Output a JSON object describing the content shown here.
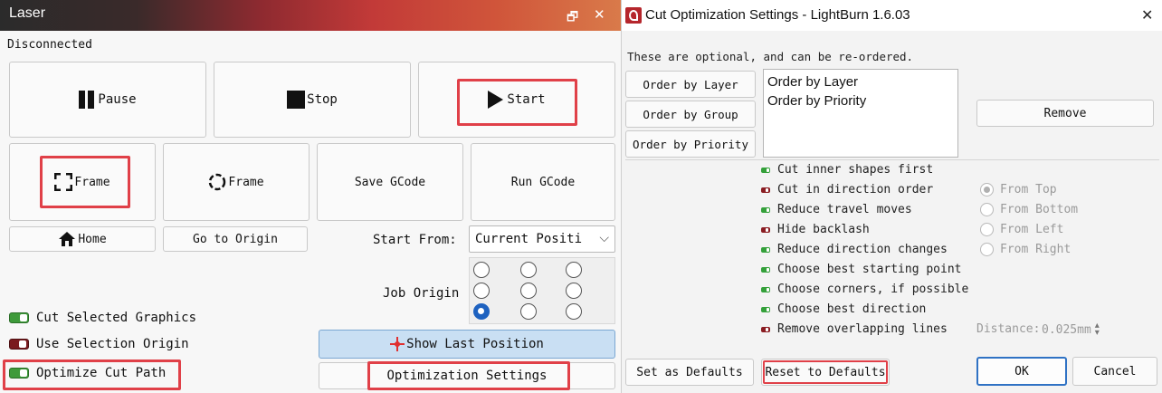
{
  "laser_panel": {
    "title": "Laser",
    "restore_glyph": "🗗",
    "close_glyph": "✕",
    "status": "Disconnected",
    "pause_label": "Pause",
    "stop_label": "Stop",
    "start_label": "Start",
    "frame_label": "Frame",
    "frame_circle_label": "Frame",
    "save_gcode_label": "Save GCode",
    "run_gcode_label": "Run GCode",
    "home_label": "Home",
    "go_to_origin_label": "Go to Origin",
    "start_from_label": "Start From:",
    "start_from_value": "Current Positi",
    "job_origin_label": "Job Origin",
    "job_origin_selected": "bottom-left",
    "cut_selected_label": "Cut Selected Graphics",
    "cut_selected_on": true,
    "use_selection_origin_label": "Use Selection Origin",
    "use_selection_origin_on": false,
    "optimize_cut_path_label": "Optimize Cut Path",
    "optimize_cut_path_on": true,
    "show_last_position_label": "Show Last Position",
    "optimization_settings_label": "Optimization Settings"
  },
  "dialog": {
    "title": "Cut Optimization Settings - LightBurn 1.6.03",
    "close_glyph": "✕",
    "intro": "These are optional, and can be re-ordered.",
    "order_by_layer_label": "Order by Layer",
    "order_by_group_label": "Order by Group",
    "order_by_priority_label": "Order by Priority",
    "order_list": [
      "Order by Layer",
      "Order by Priority"
    ],
    "remove_label": "Remove",
    "options": [
      {
        "label": "Cut inner shapes first",
        "on": true
      },
      {
        "label": "Cut in direction order",
        "on": false
      },
      {
        "label": "Reduce travel moves",
        "on": true
      },
      {
        "label": "Hide backlash",
        "on": false
      },
      {
        "label": "Reduce direction changes",
        "on": true
      },
      {
        "label": "Choose best starting point",
        "on": true
      },
      {
        "label": "Choose corners, if possible",
        "on": true
      },
      {
        "label": "Choose best direction",
        "on": true
      },
      {
        "label": "Remove overlapping lines",
        "on": false
      }
    ],
    "directions": [
      "From Top",
      "From Bottom",
      "From Left",
      "From Right"
    ],
    "direction_selected": "From Top",
    "distance_label": "Distance:",
    "distance_value": "0.025mm",
    "set_as_defaults_label": "Set as Defaults",
    "reset_to_defaults_label": "Reset to Defaults",
    "ok_label": "OK",
    "cancel_label": "Cancel"
  },
  "colors": {
    "highlight": "#e04048",
    "toggle_on": "#3e9a3a",
    "toggle_off": "#7a1a1e",
    "radio_selected": "#1e62c0",
    "show_last_position_bg": "#c9dff3"
  }
}
